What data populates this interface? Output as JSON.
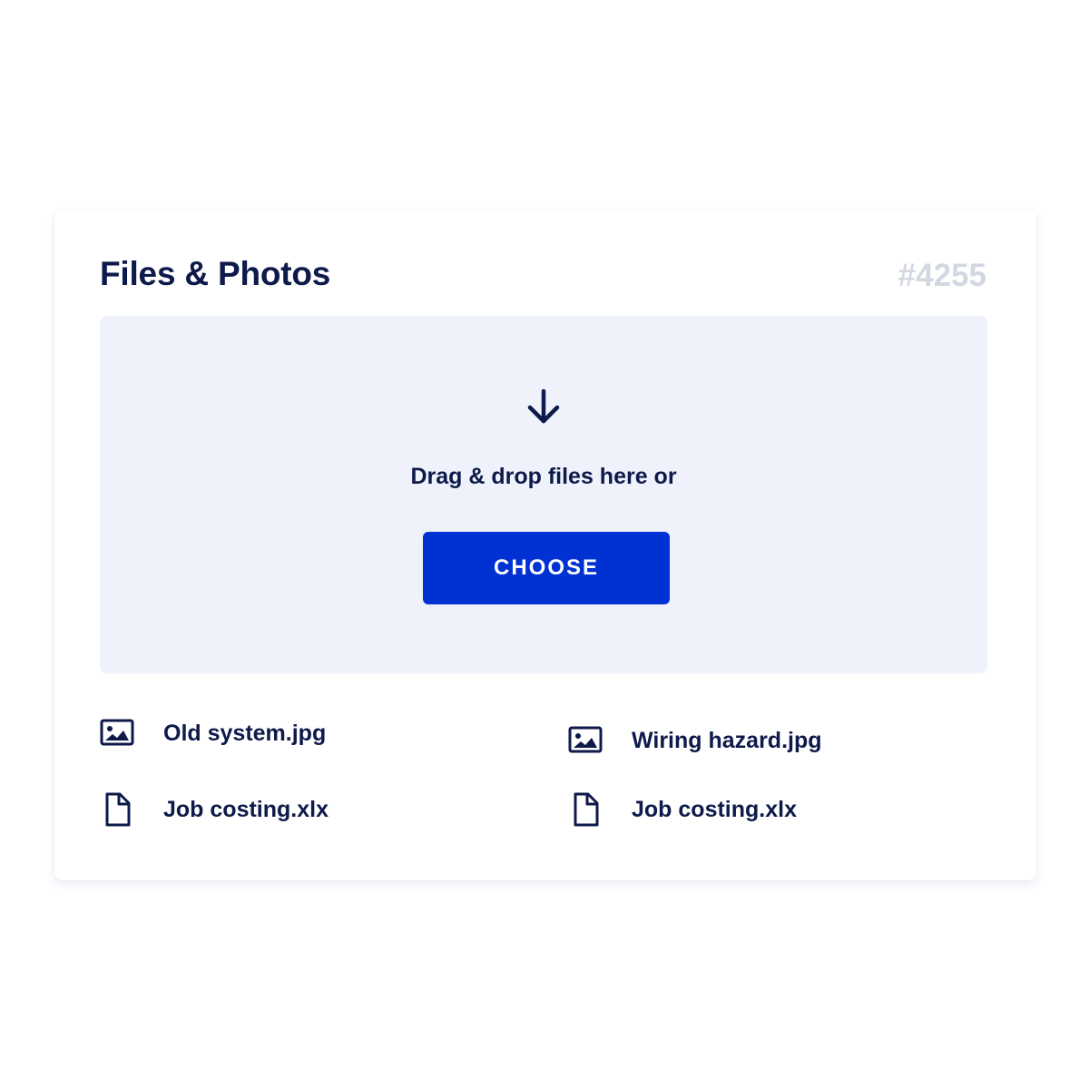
{
  "card": {
    "title": "Files & Photos",
    "job_number": "#4255"
  },
  "dropzone": {
    "icon": "arrow-down-icon",
    "text": "Drag & drop files here or",
    "button_label": "CHOOSE"
  },
  "files": [
    {
      "name": "Old system.jpg",
      "icon": "image-icon"
    },
    {
      "name": "Wiring hazard.jpg",
      "icon": "image-icon"
    },
    {
      "name": "Job costing.xlx",
      "icon": "document-icon"
    },
    {
      "name": "Job costing.xlx",
      "icon": "document-icon"
    }
  ],
  "colors": {
    "text": "#0d1a4a",
    "accent": "#0032d3",
    "dropzone_bg": "#eff2fb",
    "muted": "#d3d7e2"
  }
}
